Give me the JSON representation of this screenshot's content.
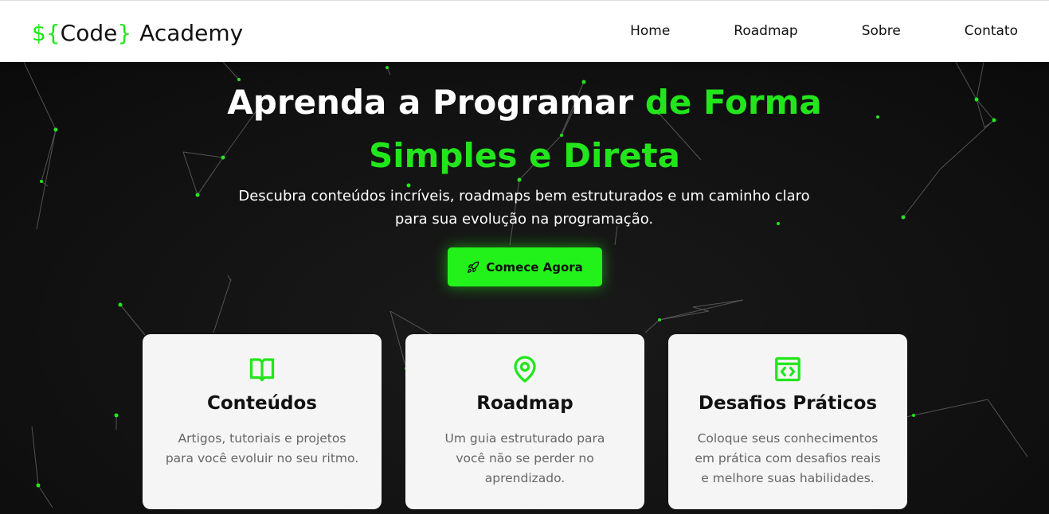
{
  "colors": {
    "accent": "#22e61b",
    "button": "#22f21a",
    "background": "#111111",
    "card": "#f5f5f5"
  },
  "logo": {
    "dollar": "$",
    "brace_open": "{",
    "code": "Code",
    "brace_close": "}",
    "academy": "Academy"
  },
  "nav": {
    "items": [
      "Home",
      "Roadmap",
      "Sobre",
      "Contato"
    ]
  },
  "hero": {
    "title_white": "Aprenda a Programar ",
    "title_green_1": "de Forma",
    "title_green_2": "Simples e Direta",
    "subtitle_1": "Descubra conteúdos incríveis, roadmaps bem estruturados e um caminho claro",
    "subtitle_2": "para sua evolução na programação.",
    "cta": {
      "icon": "rocket-icon",
      "label": "Comece Agora"
    }
  },
  "cards": [
    {
      "icon": "open-book-icon",
      "title": "Conteúdos",
      "text": [
        "Artigos, tutoriais e projetos",
        "para você evoluir no seu ritmo."
      ]
    },
    {
      "icon": "map-pin-icon",
      "title": "Roadmap",
      "text": [
        "Um guia estruturado para",
        "você não se perder no",
        "aprendizado."
      ]
    },
    {
      "icon": "code-window-icon",
      "title": "Desafios Práticos",
      "text": [
        "Coloque seus conhecimentos",
        "em prática com desafios reais",
        "e melhore suas habilidades."
      ]
    }
  ]
}
